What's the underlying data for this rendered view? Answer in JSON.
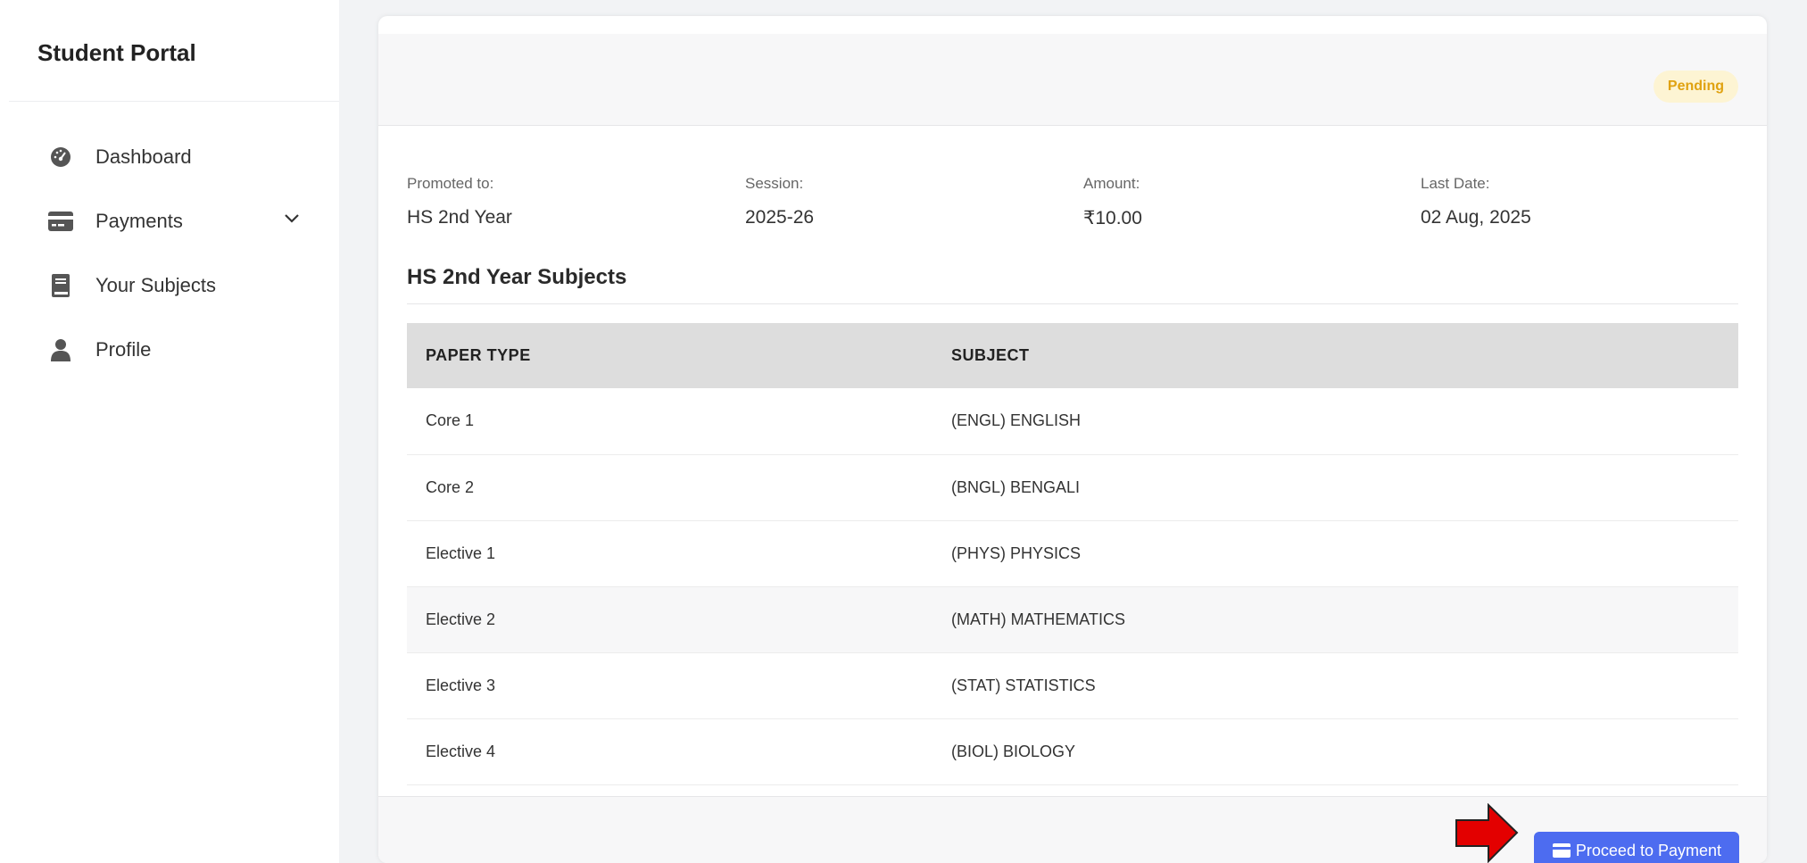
{
  "sidebar": {
    "brand": "Student Portal",
    "items": [
      {
        "label": "Dashboard",
        "icon": "dashboard-gauge-icon"
      },
      {
        "label": "Payments",
        "icon": "credit-card-icon"
      },
      {
        "label": "Your Subjects",
        "icon": "book-icon"
      },
      {
        "label": "Profile",
        "icon": "user-icon"
      }
    ]
  },
  "card": {
    "status_badge": "Pending",
    "info": [
      {
        "label": "Promoted to:",
        "value": "HS 2nd Year"
      },
      {
        "label": "Session:",
        "value": "2025-26"
      },
      {
        "label": "Amount:",
        "value": "₹10.00"
      },
      {
        "label": "Last Date:",
        "value": "02 Aug, 2025"
      }
    ],
    "subjects_title": "HS 2nd Year Subjects",
    "table": {
      "headers": [
        "PAPER TYPE",
        "SUBJECT"
      ],
      "rows": [
        [
          "Core 1",
          "(ENGL) ENGLISH"
        ],
        [
          "Core 2",
          "(BNGL) BENGALI"
        ],
        [
          "Elective 1",
          "(PHYS) PHYSICS"
        ],
        [
          "Elective 2",
          "(MATH) MATHEMATICS"
        ],
        [
          "Elective 3",
          "(STAT) STATISTICS"
        ],
        [
          "Elective 4",
          "(BIOL) BIOLOGY"
        ]
      ]
    },
    "proceed_button": "Proceed to Payment"
  },
  "colors": {
    "accent": "#4d6cf0",
    "badge_bg": "#fdf4d3",
    "badge_text": "#e0a210",
    "annotation_arrow": "#e30000"
  }
}
